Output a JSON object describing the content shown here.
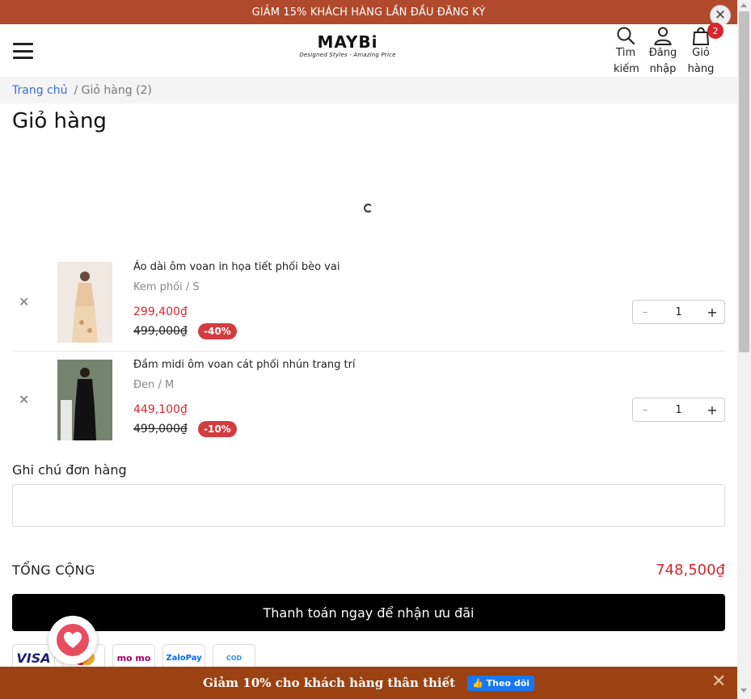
{
  "promo_top": {
    "text": "GIẢM 15% KHÁCH HÀNG LẦN ĐẦU ĐĂNG KÝ",
    "close": "✕"
  },
  "header": {
    "logo": "MAYBi",
    "tagline": "Designed Styles - Amazing Price",
    "search_label": "Tìm kiếm",
    "search_label_line1": "Tìm",
    "search_label_line2": "kiếm",
    "login_line1": "Đăng",
    "login_line2": "nhập",
    "cart_line1": "Giỏ",
    "cart_line2": "hàng",
    "cart_count": "2"
  },
  "breadcrumb": {
    "home": "Trang chủ",
    "current": "/ Giỏ hàng (2)"
  },
  "page_title": "Giỏ hàng",
  "cart": {
    "items": [
      {
        "name": "Áo dài ôm voan in họa tiết phối bèo vai",
        "variant": "Kem phối / S",
        "price": "299,400₫",
        "old_price": "499,000₫",
        "discount": "-40%",
        "quantity": "1"
      },
      {
        "name": "Đầm midi ôm voan cát phối nhún trang trí",
        "variant": "Đen / M",
        "price": "449,100₫",
        "old_price": "499,000₫",
        "discount": "-10%",
        "quantity": "1"
      }
    ]
  },
  "note": {
    "label": "Ghi chú đơn hàng",
    "value": ""
  },
  "total": {
    "label": "TỔNG CỘNG",
    "value": "748,500₫"
  },
  "checkout": {
    "label": "Thanh toán ngay để nhận ưu đãi"
  },
  "payment_methods": [
    "VISA",
    "mastercard",
    "mo mo",
    "ZaloPay",
    "COD"
  ],
  "promo_bottom": {
    "text": "Giảm 10% cho khách hàng thân thiết",
    "follow": "👍 Theo dõi",
    "close": "✕"
  },
  "colors": {
    "accent_red": "#d7262e",
    "promo_top_bg": "#b04a2c",
    "promo_bottom_bg": "#9c4212",
    "link_blue": "#3b6ec9"
  }
}
